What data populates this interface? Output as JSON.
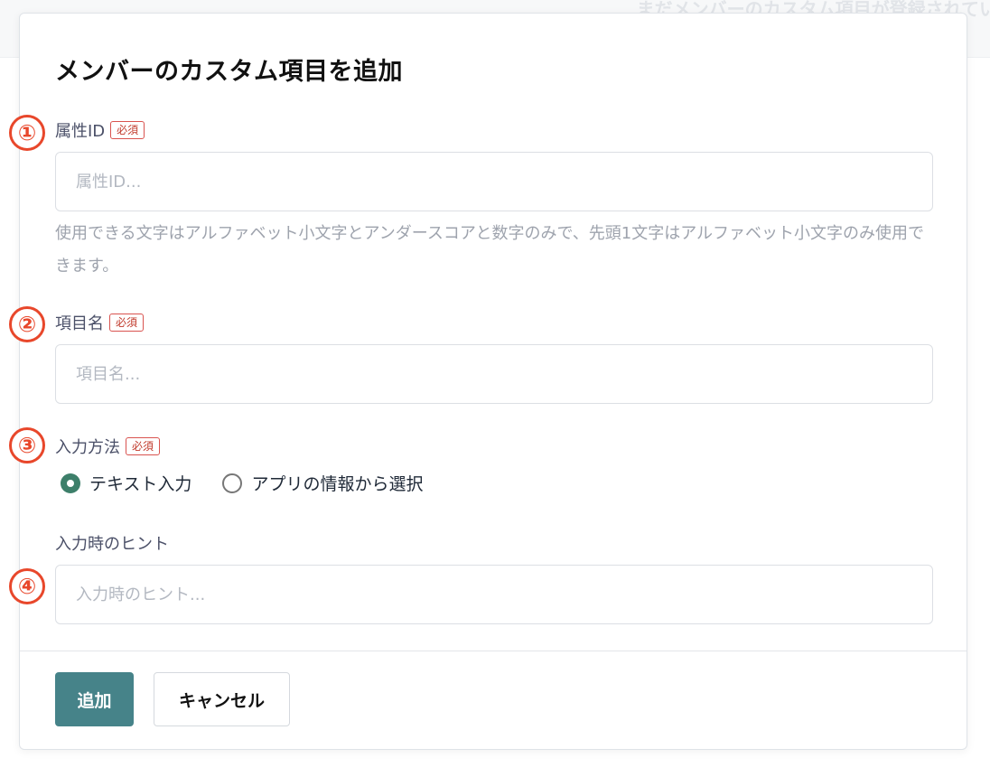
{
  "background": {
    "notice_text": "まだメンバーのカスタム項目が登録されてい"
  },
  "modal": {
    "title": "メンバーのカスタム項目を追加",
    "markers": [
      "①",
      "②",
      "③",
      "④"
    ],
    "required_badge": "必須",
    "fields": {
      "attribute_id": {
        "label": "属性ID",
        "placeholder": "属性ID...",
        "value": "",
        "help": "使用できる文字はアルファベット小文字とアンダースコアと数字のみで、先頭1文字はアルファベット小文字のみ使用できます。"
      },
      "item_name": {
        "label": "項目名",
        "placeholder": "項目名...",
        "value": ""
      },
      "input_method": {
        "label": "入力方法",
        "options": [
          {
            "label": "テキスト入力",
            "checked": true
          },
          {
            "label": "アプリの情報から選択",
            "checked": false
          }
        ]
      },
      "input_hint": {
        "label": "入力時のヒント",
        "placeholder": "入力時のヒント...",
        "value": ""
      }
    },
    "footer": {
      "add_label": "追加",
      "cancel_label": "キャンセル"
    }
  },
  "colors": {
    "accent": "#468389",
    "radio_checked": "#3d7f6a",
    "marker": "#e8472b",
    "required": "#c0392b"
  }
}
